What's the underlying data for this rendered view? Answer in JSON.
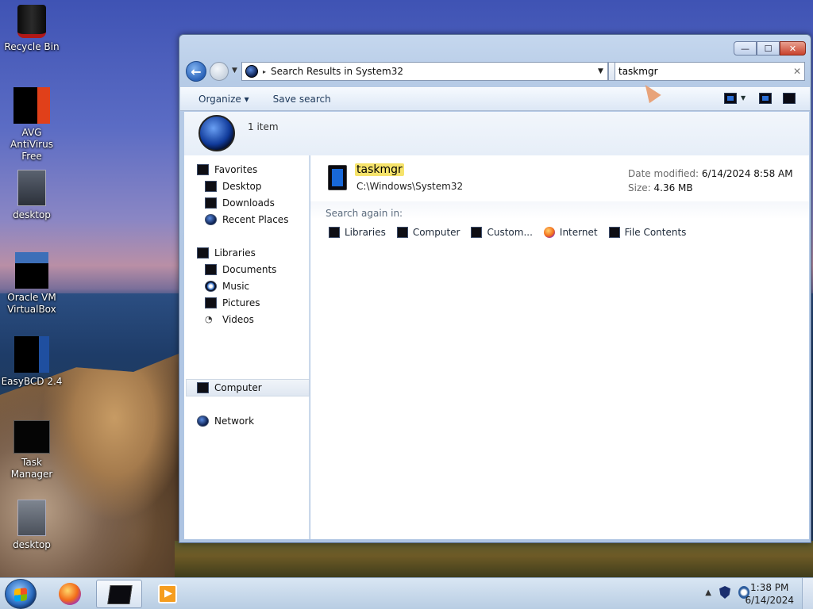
{
  "desktop": {
    "icons": [
      {
        "label": "Recycle Bin",
        "icon": "recycle-bin-icon"
      },
      {
        "label": "AVG AntiVirus Free",
        "icon": "avg-antivirus-icon"
      },
      {
        "label": "desktop",
        "icon": "document-icon"
      },
      {
        "label": "Oracle VM VirtualBox",
        "icon": "virtualbox-icon"
      },
      {
        "label": "EasyBCD 2.4",
        "icon": "easybcd-icon"
      },
      {
        "label": "Task Manager",
        "icon": "task-manager-icon"
      },
      {
        "label": "desktop",
        "icon": "document-icon"
      }
    ]
  },
  "window": {
    "caption_buttons": {
      "minimize": "—",
      "maximize": "☐",
      "close": "✕"
    },
    "address": {
      "path": "Search Results in System32",
      "separator": "▸",
      "dropdown": "▼"
    },
    "search": {
      "value": "taskmgr",
      "clear": "✕"
    },
    "toolbar": {
      "organize": "Organize ▾",
      "save_search": "Save search"
    },
    "info": {
      "item_count": "1 item"
    },
    "nav": {
      "favorites_header": "Favorites",
      "favorites": [
        "Desktop",
        "Downloads",
        "Recent Places"
      ],
      "libraries_header": "Libraries",
      "libraries": [
        "Documents",
        "Music",
        "Pictures",
        "Videos"
      ],
      "computer": "Computer",
      "network": "Network"
    },
    "result": {
      "name": "taskmgr",
      "path": "C:\\Windows\\System32",
      "date_label": "Date modified:",
      "date_value": "6/14/2024 8:58 AM",
      "size_label": "Size:",
      "size_value": "4.36 MB"
    },
    "search_again": {
      "label": "Search again in:",
      "items": [
        "Libraries",
        "Computer",
        "Custom...",
        "Internet",
        "File Contents"
      ]
    }
  },
  "taskbar": {
    "time": "1:38 PM",
    "date": "6/14/2024",
    "tray_expand": "▲"
  },
  "colors": {
    "highlight": "#f6e36b",
    "accent": "#2a62b8"
  }
}
